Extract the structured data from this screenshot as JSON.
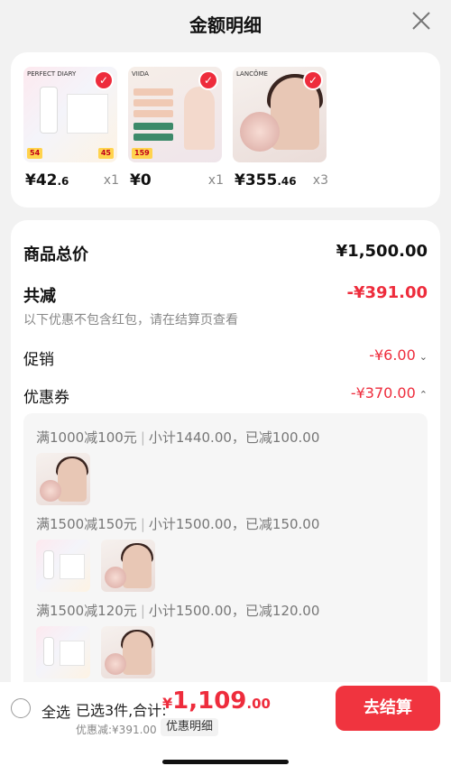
{
  "header": {
    "title": "金额明细"
  },
  "products": [
    {
      "brand": "PERFECT DIARY",
      "price_main": "¥42",
      "price_dec": ".6",
      "qty": "x1",
      "tag1": "54",
      "tag2": "45"
    },
    {
      "brand": "VIIDA",
      "price_main": "¥0",
      "price_dec": "",
      "qty": "x1",
      "tag1": "159",
      "tag2": ""
    },
    {
      "brand": "LANCÔME",
      "price_main": "¥355",
      "price_dec": ".46",
      "qty": "x3",
      "tag1": "",
      "tag2": ""
    }
  ],
  "summary": {
    "total_label": "商品总价",
    "total_value": "¥1,500.00",
    "reduce_label": "共减",
    "reduce_value": "-¥391.00",
    "note": "以下优惠不包含红包，请在结算页查看",
    "promo_label": "促销",
    "promo_value": "-¥6.00",
    "coupon_label": "优惠券",
    "coupon_value": "-¥370.00"
  },
  "coupons": [
    {
      "rule": "满1000减100元",
      "detail": "小计1440.00，已减100.00"
    },
    {
      "rule": "满1500减150元",
      "detail": "小计1500.00，已减150.00"
    },
    {
      "rule": "满1500减120元",
      "detail": "小计1500.00，已减120.00"
    }
  ],
  "footer": {
    "select_all": "全选",
    "selected": "已选3件,合计:",
    "total_yen": "¥",
    "total_main": "1,109",
    "total_dec": ".00",
    "discount": "优惠减:¥391.00",
    "detail_link": "优惠明细",
    "checkout": "去结算"
  },
  "colors": {
    "accent": "#ee2c3c",
    "checkout_bg": "#f0343f"
  }
}
